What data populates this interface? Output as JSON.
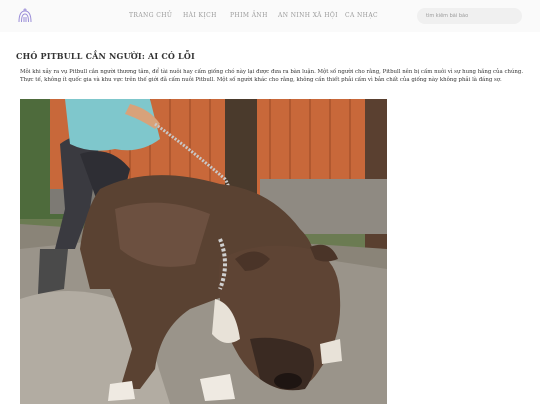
{
  "header": {
    "nav": [
      "TRANG CHỦ",
      "HÀI KỊCH",
      "PHIM ẢNH",
      "AN NINH XÃ HỘI",
      "CA NHẠC"
    ],
    "search_placeholder": "tìm kiếm bài báo"
  },
  "article": {
    "title": "CHÓ PITBULL CẮN NGƯỜI: AI CÓ LỖI",
    "body": "Mỗi khi xảy ra vụ Pitbull cắn người thương tâm, để tài nuôi hay cấm giống chó này lại được đưa ra bàn luận. Một số người cho rằng, Pitbull nên bị cấm nuôi vì sự hung hăng của chúng. Thực tế, không ít quốc gia và khu vực trên thế giới đã cấm nuôi Pitbull. Một số người khác cho rằng, không cần thiết phải cấm vì bản chất của giống này không phải là đáng sợ."
  },
  "colors": {
    "logo": "#9b8ed8",
    "fence": "#c8683a",
    "dog": "#5a4232",
    "ground": "#8a8478"
  }
}
